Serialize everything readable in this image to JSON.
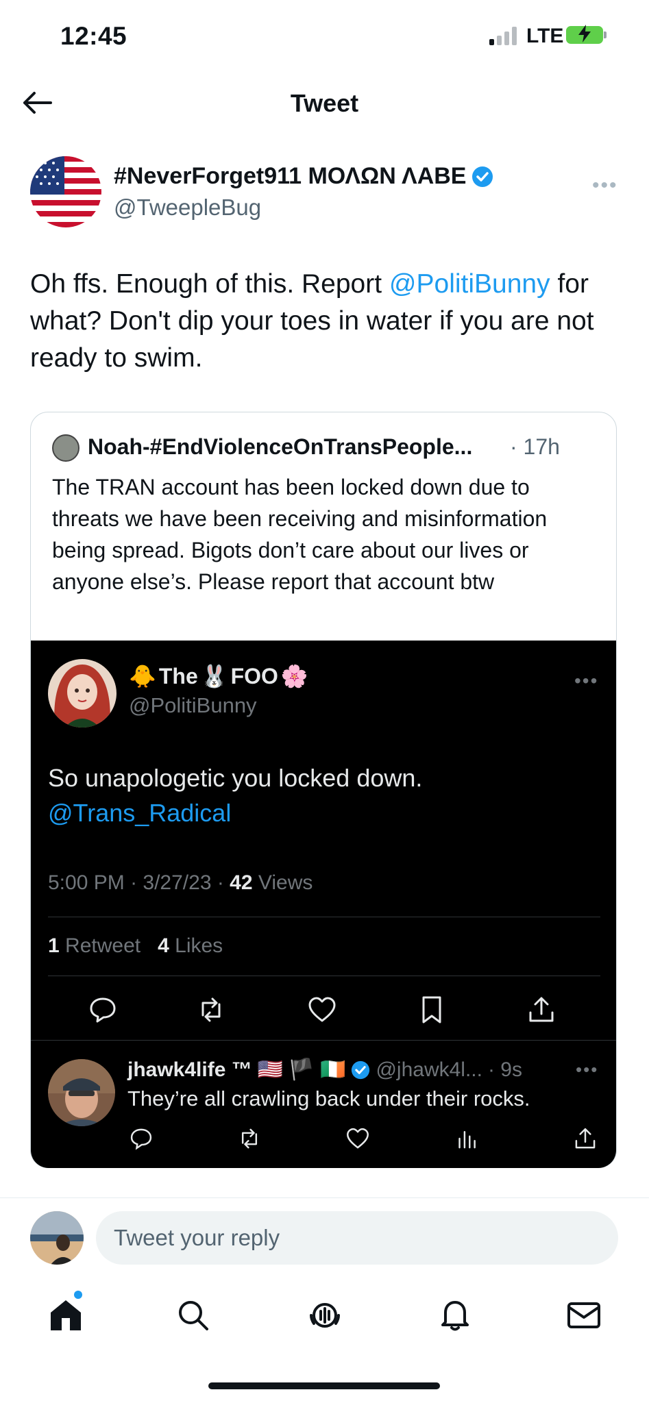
{
  "status_bar": {
    "time": "12:45",
    "network": "LTE"
  },
  "header": {
    "title": "Tweet",
    "back_icon": "arrow-left-icon"
  },
  "tweet": {
    "author_name": "#NeverForget911 ΜΟΛΩΝ ΛΑΒΕ",
    "author_handle": "@TweepleBug",
    "verified": true,
    "text_before": "Oh ffs.  Enough of this.  Report ",
    "mention": "@PolitiBunny",
    "text_after": " for what?  Don't dip your toes in water if you are not ready to swim."
  },
  "quoted": {
    "author_name": "Noah-#EndViolenceOnTransPeople...",
    "time": "· 17h",
    "text": "The TRAN account has been locked down due to threats we have been receiving and misinformation being spread. Bigots don’t care about our lives or anyone else’s. Please report that account btw",
    "embedded": {
      "author_name_prefix": "🐥",
      "author_name_word1": "The",
      "author_name_rabbit": "🐰",
      "author_name_word2": "FOO",
      "author_name_suffix": "🌸",
      "author_handle": "@PolitiBunny",
      "text": "So unapologetic you locked down.",
      "mention": "@Trans_Radical",
      "time": "5:00 PM",
      "date": "3/27/23",
      "views_count": "42",
      "views_label": "Views",
      "retweets_count": "1",
      "retweets_label": "Retweet",
      "likes_count": "4",
      "likes_label": "Likes",
      "reply": {
        "author_name": "jhawk4life ™",
        "flags": "🇺🇸 🏴 🇮🇪",
        "author_handle": "@jhawk4l...",
        "time": "· 9s",
        "text": "They’re all crawling back under their rocks."
      }
    }
  },
  "reply_bar": {
    "placeholder": "Tweet your reply"
  },
  "tab_bar": {
    "items": [
      "home-icon",
      "search-icon",
      "spaces-icon",
      "notifications-icon",
      "messages-icon"
    ]
  },
  "colors": {
    "accent": "#1d9bf0",
    "text": "#0f1419",
    "secondary": "#536471",
    "battery": "#5fcf4a"
  }
}
